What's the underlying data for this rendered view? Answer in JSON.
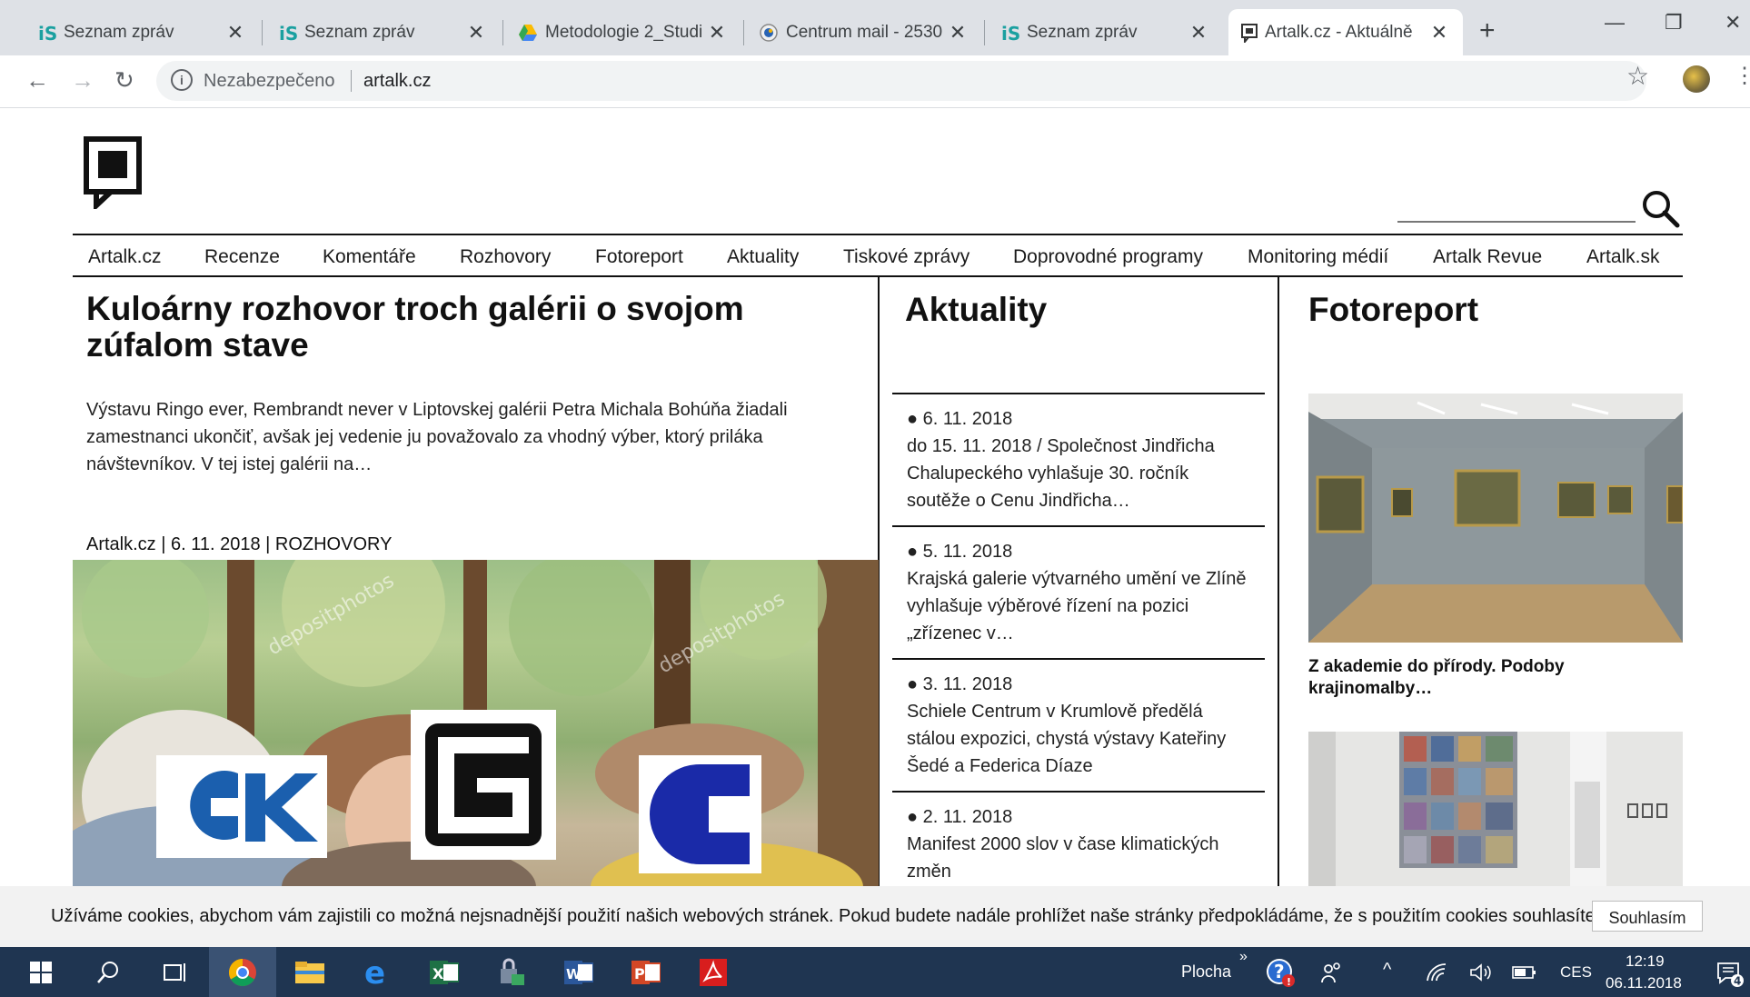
{
  "tabs": [
    {
      "title": "Seznam zpráv",
      "icon": "seznam-icon"
    },
    {
      "title": "Seznam zpráv",
      "icon": "seznam-icon"
    },
    {
      "title": "Metodologie 2_Studi",
      "icon": "google-drive-icon"
    },
    {
      "title": "Centrum mail - 2530",
      "icon": "centrum-mail-icon"
    },
    {
      "title": "Seznam zpráv",
      "icon": "seznam-icon"
    },
    {
      "title": "Artalk.cz - Aktuálně",
      "icon": "artalk-favicon-icon"
    }
  ],
  "address": {
    "security_label": "Nezabezpečeno",
    "url": "artalk.cz"
  },
  "nav": [
    "Artalk.cz",
    "Recenze",
    "Komentáře",
    "Rozhovory",
    "Fotoreport",
    "Aktuality",
    "Tiskové zprávy",
    "Doprovodné programy",
    "Monitoring médií",
    "Artalk Revue",
    "Artalk.sk"
  ],
  "article": {
    "title": "Kuloárny rozhovor troch galérii o svojom zúfalom stave",
    "excerpt": "Výstavu Ringo ever, Rembrandt never v Liptovskej galérii Petra Michala Bohúňa žiadali zamestnanci ukončiť, avšak jej vedenie ju považovalo za vhodný výber, ktorý priláka návštevníkov. V tej istej galérii na…",
    "meta": "Artalk.cz | 6. 11. 2018 | ROZHOVORY",
    "watermark": "depositphotos"
  },
  "aktuality": {
    "title": "Aktuality",
    "items": [
      {
        "date": "● 6. 11. 2018",
        "text": "do 15. 11. 2018 / Společnost Jindřicha Chalupeckého vyhlašuje 30. ročník soutěže o Cenu Jindřicha…"
      },
      {
        "date": "● 5. 11. 2018",
        "text": "Krajská galerie výtvarného umění ve Zlíně vyhlašuje výběrové řízení na pozici „zřízenec v…"
      },
      {
        "date": "● 3. 11. 2018",
        "text": "Schiele Centrum v Krumlově předělá stálou expozici, chystá výstavy Kateřiny Šedé a Federica Díaze"
      },
      {
        "date": "● 2. 11. 2018",
        "text": "Manifest 2000 slov v čase klimatických změn"
      }
    ]
  },
  "fotoreport": {
    "title": "Fotoreport",
    "caption": "Z akademie do přírody. Podoby krajinomalby…"
  },
  "cookie": {
    "text": "Užíváme cookies, abychom vám zajistili co možná nejsnadnější použití našich webových stránek. Pokud budete nadále prohlížet naše stránky předpokládáme, že s použitím cookies souhlasíte.",
    "button": "Souhlasím"
  },
  "taskbar": {
    "desktop_label": "Plocha",
    "language": "CES",
    "time": "12:19",
    "date": "06.11.2018",
    "notifications": "4"
  },
  "colors": {
    "taskbar": "#1f3551",
    "chrome_tabstrip": "#dee1e6",
    "cookie_bar": "#f2f2f2"
  }
}
